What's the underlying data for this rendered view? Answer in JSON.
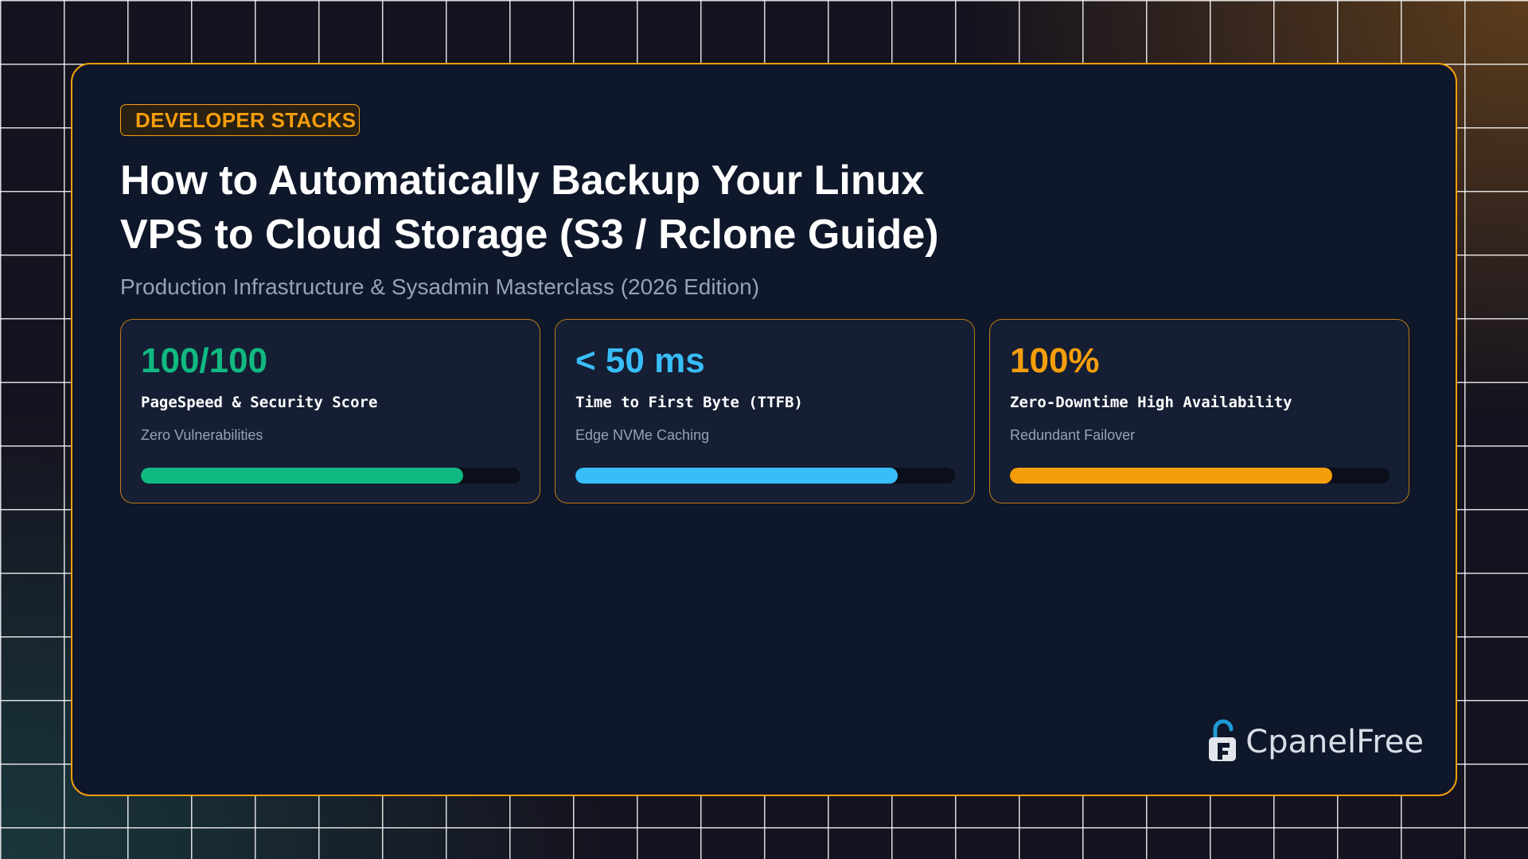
{
  "badge": {
    "label": "DEVELOPER STACKS"
  },
  "header": {
    "title_line1": "How to Automatically Backup Your Linux",
    "title_line2": "VPS to Cloud Storage (S3 / Rclone Guide)",
    "subtitle": "Production Infrastructure & Sysadmin Masterclass (2026 Edition)"
  },
  "stats": [
    {
      "value": "100/100",
      "label": "PageSpeed & Security Score",
      "sub": "Zero Vulnerabilities",
      "color": "#10b981",
      "progress": 0.85
    },
    {
      "value": "< 50 ms",
      "label": "Time to First Byte (TTFB)",
      "sub": "Edge NVMe Caching",
      "color": "#38bdf8",
      "progress": 0.85
    },
    {
      "value": "100%",
      "label": "Zero-Downtime High Availability",
      "sub": "Redundant Failover",
      "color": "#f59e0b",
      "progress": 0.85
    }
  ],
  "brand": {
    "name": "CpanelFree",
    "icon": "padlock-logo-icon"
  },
  "colors": {
    "accent": "#f59e0b",
    "card_background": "#0f172a"
  }
}
